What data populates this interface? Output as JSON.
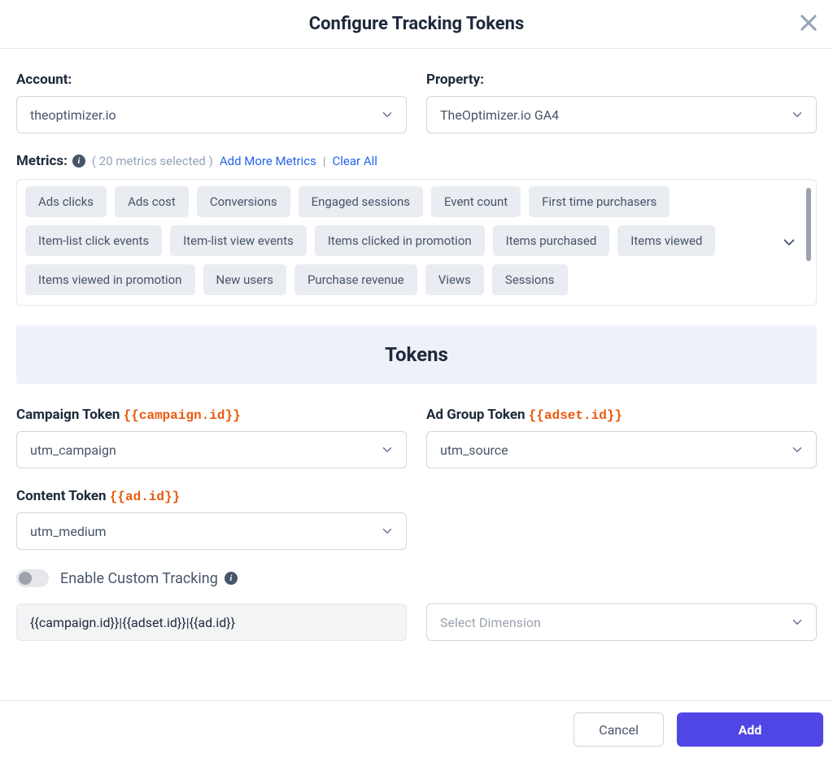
{
  "header": {
    "title": "Configure Tracking Tokens"
  },
  "account": {
    "label": "Account:",
    "value": "theoptimizer.io"
  },
  "property": {
    "label": "Property:",
    "value": "TheOptimizer.io GA4"
  },
  "metrics": {
    "label": "Metrics:",
    "selected_count_text": "( 20 metrics selected )",
    "add_more_label": "Add More Metrics",
    "clear_all_label": "Clear All",
    "chips": [
      "Ads clicks",
      "Ads cost",
      "Conversions",
      "Engaged sessions",
      "Event count",
      "First time purchasers",
      "Item-list click events",
      "Item-list view events",
      "Items clicked in promotion",
      "Items purchased",
      "Items viewed",
      "Items viewed in promotion",
      "New users",
      "Purchase revenue",
      "Views",
      "Sessions"
    ]
  },
  "tokens": {
    "section_title": "Tokens",
    "campaign": {
      "label": "Campaign Token ",
      "code": "{{campaign.id}}",
      "value": "utm_campaign"
    },
    "adgroup": {
      "label": "Ad Group Token ",
      "code": "{{adset.id}}",
      "value": "utm_source"
    },
    "content": {
      "label": "Content Token ",
      "code": "{{ad.id}}",
      "value": "utm_medium"
    }
  },
  "custom": {
    "toggle_label": "Enable Custom Tracking",
    "pattern_value": "{{campaign.id}}|{{adset.id}}|{{ad.id}}",
    "dimension_placeholder": "Select Dimension"
  },
  "footer": {
    "cancel": "Cancel",
    "add": "Add"
  }
}
